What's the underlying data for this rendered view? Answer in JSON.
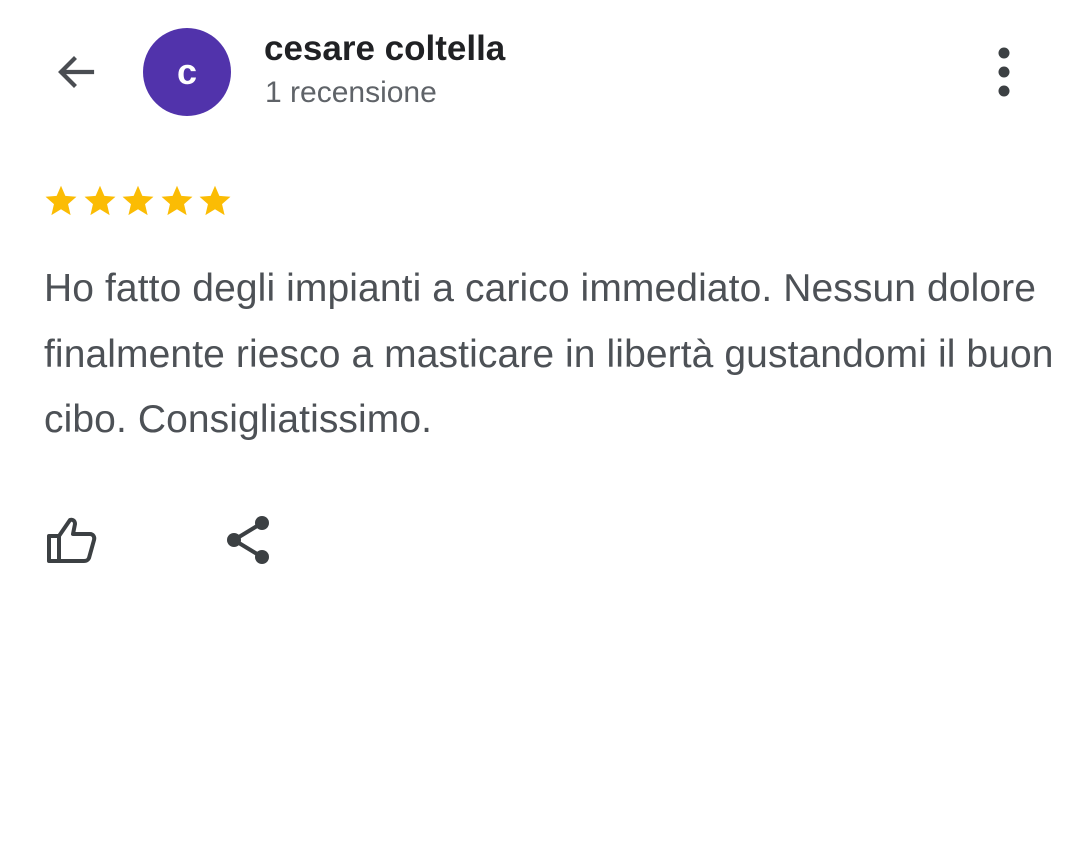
{
  "header": {
    "author_name": "cesare coltella",
    "review_count": "1 recensione",
    "avatar_letter": "c",
    "avatar_color": "#5133ab",
    "back_icon": "arrow-back-icon",
    "more_icon": "more-vertical-icon"
  },
  "review": {
    "rating": 5,
    "rating_max": 5,
    "star_color": "#fbbc04",
    "text": "Ho fatto degli impianti a carico immediato. Nessun dolore finalmente riesco a masticare in libertà gustandomi il buon cibo. Consigliatissimo."
  },
  "actions": {
    "like_icon": "thumb-up-icon",
    "share_icon": "share-icon"
  },
  "colors": {
    "primary_text": "#202124",
    "secondary_text": "#5f6368",
    "body_text": "#4d5156",
    "icon": "#3c4043"
  }
}
